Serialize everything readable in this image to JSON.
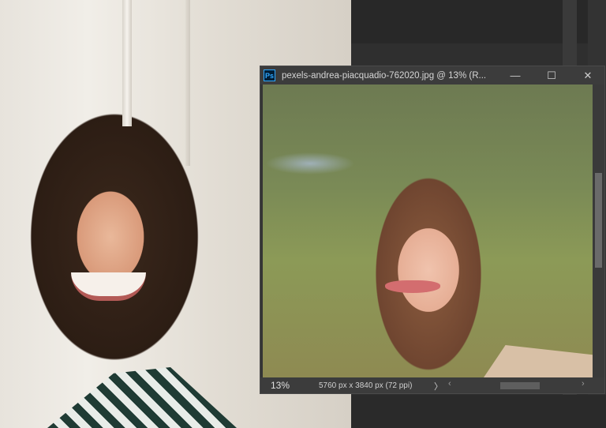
{
  "document": {
    "title": "pexels-andrea-piacquadio-762020.jpg @ 13% (R...",
    "app_icon": "Ps"
  },
  "window_controls": {
    "minimize": "—",
    "maximize": "☐",
    "close": "✕"
  },
  "status": {
    "zoom": "13%",
    "info": "5760 px x 3840 px (72 ppi)",
    "arrow": "〉"
  },
  "icons": {
    "scroll_left": "‹",
    "scroll_right": "›"
  },
  "colors": {
    "ps_blue": "#31a8ff",
    "titlebar": "#3c3c3c",
    "workspace": "#2f2f2f"
  }
}
